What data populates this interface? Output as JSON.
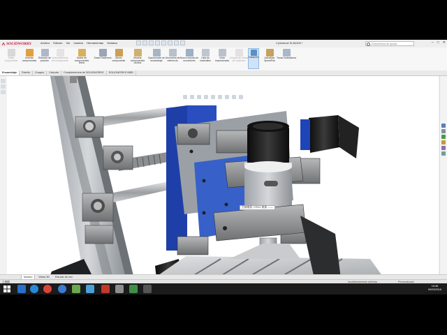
{
  "app": {
    "logo_text": "SOLIDWORKS",
    "document_title": "Cylindrical SLBASM *",
    "window_controls": [
      "–",
      "□",
      "✕"
    ]
  },
  "menu": [
    "Archivo",
    "Edición",
    "Ver",
    "Insertar",
    "Herramientas",
    "Ventana"
  ],
  "search": {
    "placeholder": "Documentos de ayuda"
  },
  "ribbon": [
    {
      "label": "Editar componente",
      "icon": "edit-component-icon",
      "enabled": false
    },
    {
      "label": "Insertar componentes",
      "icon": "insert-components-icon",
      "enabled": true
    },
    {
      "label": "Relación de posición",
      "icon": "mate-icon",
      "enabled": true
    },
    {
      "label": "Vista preliminar del componente",
      "icon": "component-preview-icon",
      "enabled": false
    },
    {
      "label": "Matriz de componentes lineal",
      "icon": "linear-pattern-icon",
      "enabled": true
    },
    {
      "label": "Smart Fasteners",
      "icon": "smart-fasteners-icon",
      "enabled": true
    },
    {
      "label": "Mover componente",
      "icon": "move-component-icon",
      "enabled": true
    },
    {
      "label": "Mostrar componentes ocultos",
      "icon": "show-hidden-icon",
      "enabled": true
    },
    {
      "label": "Operaciones de ensamblaje",
      "icon": "assembly-features-icon",
      "enabled": true
    },
    {
      "label": "Geometría de referencia",
      "icon": "reference-geometry-icon",
      "enabled": true
    },
    {
      "label": "Nuevo estudio de movimiento",
      "icon": "motion-study-icon",
      "enabled": true
    },
    {
      "label": "Lista de materiales",
      "icon": "bom-icon",
      "enabled": true
    },
    {
      "label": "Vista explosionada",
      "icon": "exploded-view-icon",
      "enabled": true
    },
    {
      "label": "Croquis de líneas de explosión",
      "icon": "explode-line-icon",
      "enabled": false
    },
    {
      "label": "Instant3D",
      "icon": "instant3d-icon",
      "enabled": true,
      "active": true
    },
    {
      "label": "Actualizar SpeedPak",
      "icon": "speedpak-icon",
      "enabled": true
    },
    {
      "label": "Tomar instantánea",
      "icon": "snapshot-icon",
      "enabled": true
    }
  ],
  "command_tabs": [
    {
      "label": "Ensamblaje",
      "active": true
    },
    {
      "label": "Diseño",
      "active": false
    },
    {
      "label": "Croquis",
      "active": false
    },
    {
      "label": "Calcular",
      "active": false
    },
    {
      "label": "Complementos de SOLIDWORKS",
      "active": false
    },
    {
      "label": "SOLIDWORKS MBD",
      "active": false
    }
  ],
  "viewport": {
    "annotation": "主轴电机 / ER11 收紧 ——"
  },
  "bottom_tabs": [
    {
      "label": "Modelo",
      "active": true
    },
    {
      "label": "Vistas 3D",
      "active": false
    },
    {
      "label": "Estudio de movimiento 1",
      "active": false
    }
  ],
  "status": {
    "left": "工程图",
    "center": "Insuficientemente definida",
    "right": "Personalizado"
  },
  "taskbar": {
    "time": "15:48",
    "date": "09/03/2016",
    "apps": [
      "start-icon",
      "ie-icon",
      "explorer-icon",
      "chrome-icon",
      "edge-icon",
      "solidworks-icon",
      "notepad-icon",
      "folder-icon",
      "vlc-icon",
      "media-icon",
      "recorder-icon",
      "app-icon"
    ]
  }
}
